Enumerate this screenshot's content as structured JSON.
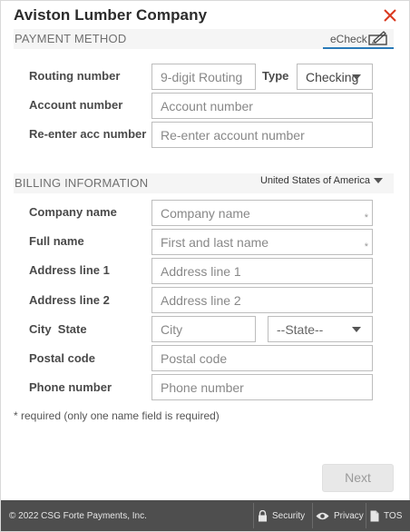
{
  "header": {
    "title": "Aviston Lumber Company"
  },
  "payment_method": {
    "section_label": "PAYMENT METHOD",
    "tab_label": "eCheck",
    "fields": {
      "routing": {
        "label": "Routing number",
        "placeholder": "9-digit Routing"
      },
      "type": {
        "label": "Type",
        "value": "Checking"
      },
      "account": {
        "label": "Account number",
        "placeholder": "Account number"
      },
      "reenter": {
        "label": "Re-enter acc number",
        "placeholder": "Re-enter account number"
      }
    }
  },
  "billing": {
    "section_label": "BILLING INFORMATION",
    "country": "United States of America",
    "fields": {
      "company": {
        "label": "Company name",
        "placeholder": "Company name",
        "required_mark": "*"
      },
      "full_name": {
        "label": "Full name",
        "placeholder": "First and last name",
        "required_mark": "*"
      },
      "address1": {
        "label": "Address line 1",
        "placeholder": "Address line 1"
      },
      "address2": {
        "label": "Address line 2",
        "placeholder": "Address line 2"
      },
      "city_state": {
        "label": "City  State",
        "city_placeholder": "City",
        "state_value": "--State--"
      },
      "postal": {
        "label": "Postal code",
        "placeholder": "Postal code"
      },
      "phone": {
        "label": "Phone number",
        "placeholder": "Phone number"
      }
    }
  },
  "note": "* required  (only one name field is required)",
  "actions": {
    "next_label": "Next"
  },
  "footer": {
    "copyright": "© 2022 CSG Forte Payments, Inc.",
    "security": "Security",
    "privacy": "Privacy",
    "tos": "TOS"
  },
  "colors": {
    "close": "#d9381e",
    "accent": "#2a7ab8",
    "footer_bg": "#4e4e4e"
  }
}
